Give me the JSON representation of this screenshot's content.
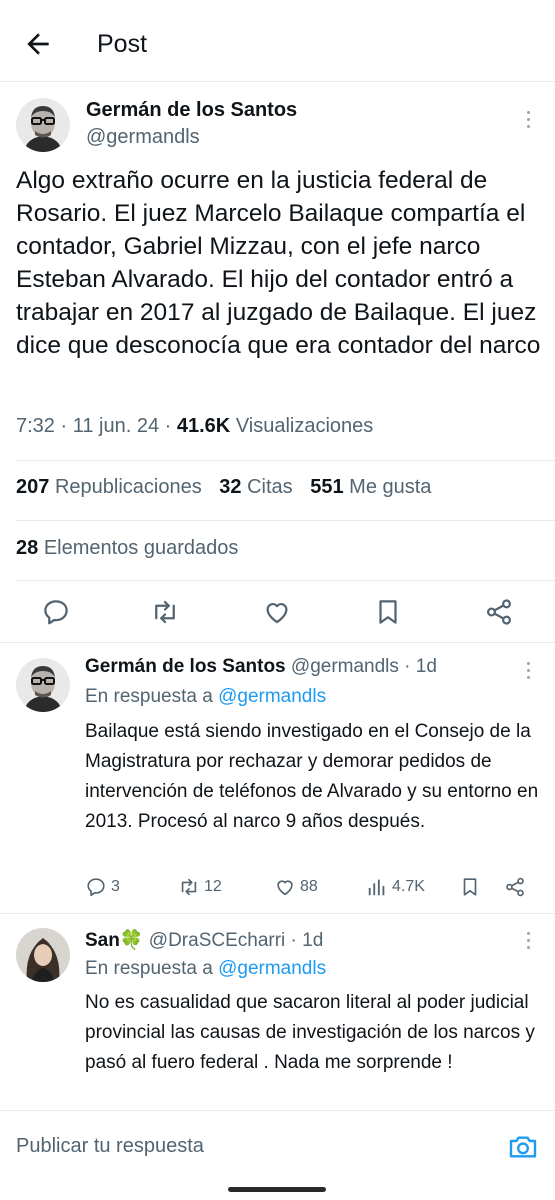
{
  "header": {
    "title": "Post"
  },
  "post": {
    "author_name": "Germán de los Santos",
    "author_handle": "@germandls",
    "text": "Algo extraño ocurre en la justicia federal de Rosario. El juez Marcelo Bailaque compartía el contador, Gabriel Mizzau, con el jefe narco Esteban Alvarado. El hijo del contador entró a trabajar en 2017 al juzgado de Bailaque. El juez dice que desconocía que era contador del narco",
    "time": "7:32",
    "sep": " · ",
    "date": "11 jun. 24",
    "views_count": "41.6K",
    "views_label": "Visualizaciones",
    "reposts_count": "207",
    "reposts_label": "Republicaciones",
    "quotes_count": "32",
    "quotes_label": "Citas",
    "likes_count": "551",
    "likes_label": "Me gusta",
    "bookmarks_count": "28",
    "bookmarks_label": "Elementos guardados"
  },
  "replies": [
    {
      "name": "Germán de los Santos",
      "handle": "@germandls",
      "age": "1d",
      "reply_prefix": "En respuesta a",
      "reply_to": "@germandls",
      "text": "Bailaque está siendo investigado en el Consejo de la Magistratura por rechazar y demorar pedidos de intervención de teléfonos de Alvarado y su entorno en 2013. Procesó al narco 9 años después.",
      "replies": "3",
      "reposts": "12",
      "likes": "88",
      "views": "4.7K"
    },
    {
      "name": "San🍀",
      "handle": "@DraSCEcharri",
      "age": "1d",
      "reply_prefix": "En respuesta a",
      "reply_to": "@germandls",
      "text": "No es casualidad que sacaron literal al poder judicial provincial las causas de investigación de los narcos y pasó al fuero federal . Nada me sorprende !"
    }
  ],
  "composer": {
    "placeholder": "Publicar tu respuesta"
  },
  "icons": {
    "back": "arrow-left-icon",
    "more": "more-vertical-icon",
    "reply": "reply-icon",
    "repost": "repost-icon",
    "like": "heart-icon",
    "bookmark": "bookmark-icon",
    "share": "share-icon",
    "views": "views-icon",
    "camera": "camera-icon"
  },
  "colors": {
    "accent": "#1d9bf0",
    "text": "#0f1419",
    "secondary": "#536471",
    "divider": "#e6e9ec"
  }
}
